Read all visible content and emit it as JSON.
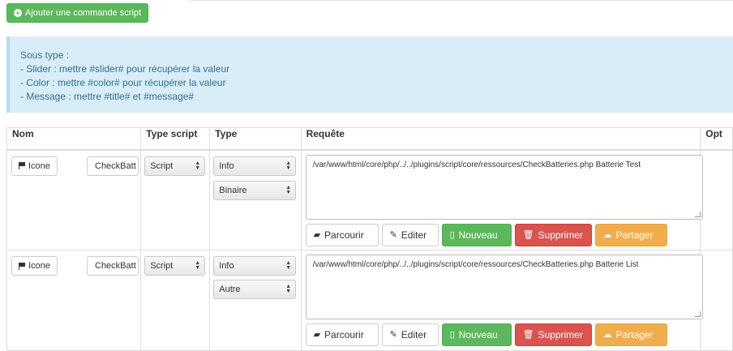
{
  "add_button": {
    "label": "Ajouter une commande script",
    "icon": "plus-circle-icon"
  },
  "info": {
    "lines": [
      "Sous type :",
      "- Slider : mettre #slider# pour récupérer la valeur",
      "- Color : mettre #color# pour récupérer la valeur",
      "- Message : mettre #title# et #message#"
    ]
  },
  "table": {
    "headers": {
      "nom": "Nom",
      "type_script": "Type script",
      "type": "Type",
      "requete": "Requête",
      "options": "Opt"
    },
    "rows": [
      {
        "icon_button": "Icone",
        "name_value": "CheckBatt",
        "type_script": "Script",
        "type": "Info",
        "subtype": "Binaire",
        "request": "/var/www/html/core/php/../../plugins/script/core/ressources/CheckBatteries.php Batterie Test"
      },
      {
        "icon_button": "Icone",
        "name_value": "CheckBatt",
        "type_script": "Script",
        "type": "Info",
        "subtype": "Autre",
        "request": "/var/www/html/core/php/../../plugins/script/core/ressources/CheckBatteries.php Batterie List"
      }
    ],
    "actions": {
      "browse": "Parcourir",
      "edit": "Editer",
      "new": "Nouveau",
      "delete": "Supprimer",
      "share": "Partager"
    }
  },
  "colors": {
    "success": "#5cb85c",
    "danger": "#d9534f",
    "warning": "#f0ad4e",
    "info_bg": "#d9edf7",
    "info_text": "#31708f"
  }
}
